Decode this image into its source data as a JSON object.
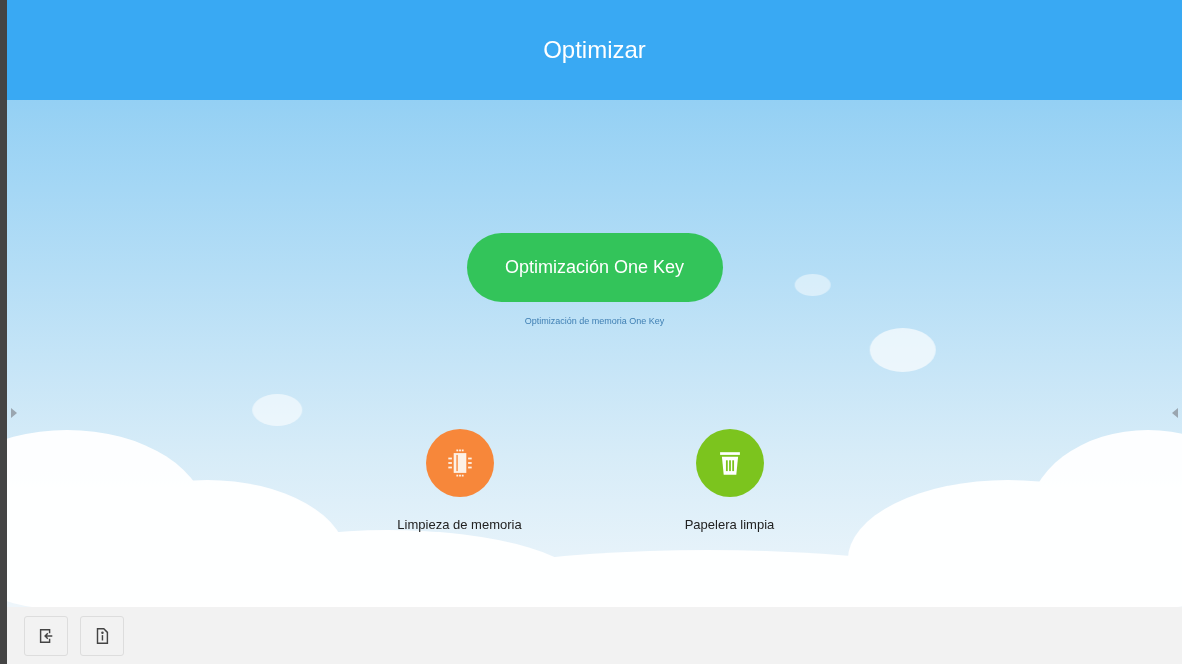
{
  "header": {
    "title": "Optimizar"
  },
  "main_action": {
    "label": "Optimización One Key",
    "caption": "Optimización de memoria One Key"
  },
  "tools": [
    {
      "kind": "memory",
      "label": "Limpieza de memoria",
      "color": "#f7873a"
    },
    {
      "kind": "trash",
      "label": "Papelera limpia",
      "color": "#7cc41e"
    }
  ],
  "toolbar": [
    {
      "kind": "exit"
    },
    {
      "kind": "info"
    }
  ]
}
